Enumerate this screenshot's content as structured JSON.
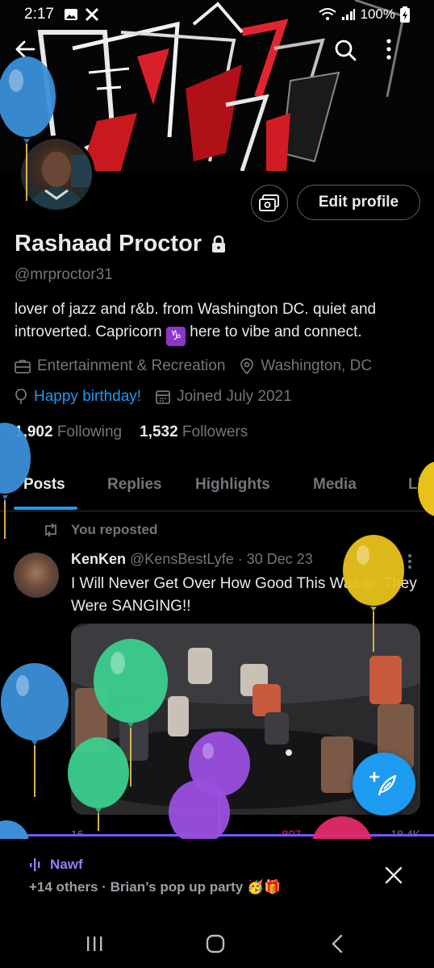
{
  "status_bar": {
    "time": "2:17",
    "battery": "100%"
  },
  "profile": {
    "name": "Rashaad Proctor",
    "handle": "@mrproctor31",
    "bio": "lover of jazz and r&b. from Washington DC. quiet and introverted. Capricorn",
    "bio_emoji": "♑",
    "bio_end": " here to vibe and connect.",
    "category": "Entertainment & Recreation",
    "location": "Washington, DC",
    "birthday": "Happy birthday!",
    "joined": "Joined July 2021",
    "following_count": "1,902",
    "following_label": "Following",
    "followers_count": "1,532",
    "followers_label": "Followers",
    "edit_label": "Edit profile"
  },
  "tabs": [
    "Posts",
    "Replies",
    "Highlights",
    "Media",
    "Likes"
  ],
  "post": {
    "repost_label": "You reposted",
    "author": "KenKen",
    "handle": "@KensBestLyfe",
    "date": "· 30 Dec 23",
    "text": "I Will Never Get Over How Good This Was👏🏾 They Were SANGING!!",
    "counts": {
      "replies": "16",
      "reposts": "208",
      "likes": "807",
      "views": "18.4K"
    }
  },
  "spaces": {
    "host": "Nawf",
    "subtitle": "+14 others · Brian’s pop up party 🥳🎁"
  },
  "colors": {
    "accent_blue": "#1d9bf0",
    "spaces_purple": "#7856ff",
    "muted_text": "#71767b",
    "balloon_blue": "#3a8fd8",
    "balloon_green": "#3ccf8e",
    "balloon_purple": "#9b4fe0",
    "balloon_yellow": "#e8c21a"
  },
  "icons": [
    "back-arrow-icon",
    "search-icon",
    "more-vertical-icon",
    "lock-icon",
    "briefcase-icon",
    "location-pin-icon",
    "balloon-icon",
    "calendar-icon",
    "repost-icon",
    "compose-icon",
    "spaces-wave-icon",
    "close-icon"
  ]
}
